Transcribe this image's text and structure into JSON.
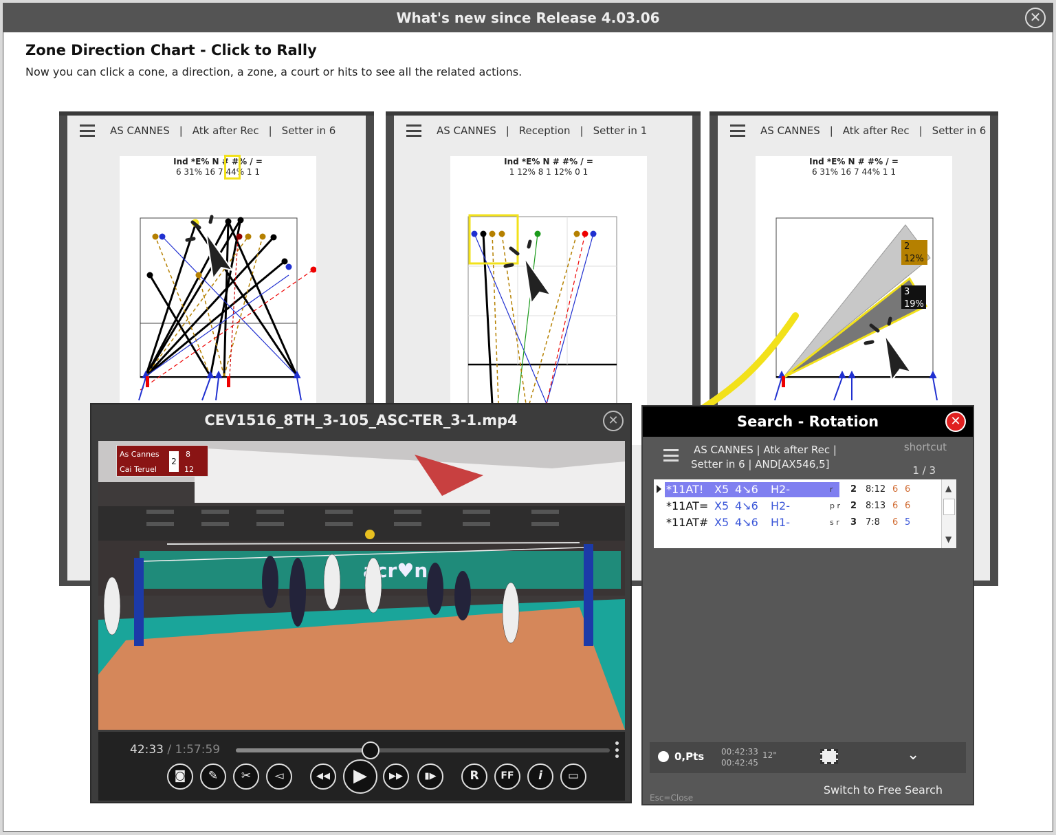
{
  "window": {
    "title": "What's new since Release 4.03.06",
    "close_label": "✕"
  },
  "intro": {
    "heading": "Zone Direction Chart - Click to Rally",
    "subheading": "Now you can click a cone, a direction, a zone, a court or hits to see all the related actions."
  },
  "panels": [
    {
      "team": "AS CANNES",
      "skill": "Atk after Rec",
      "rotation": "Setter in 6",
      "stats_header": "Ind *E% N  #  #%  /  =",
      "stats_values": "6  31% 16  7  44%  1  1"
    },
    {
      "team": "AS CANNES",
      "skill": "Reception",
      "rotation": "Setter in 1",
      "stats_header": "Ind *E% N  #  #%  /  =",
      "stats_values": "1  12%  8  1  12%  0  1"
    },
    {
      "team": "AS CANNES",
      "skill": "Atk after Rec",
      "rotation": "Setter in 6",
      "stats_header": "Ind *E% N  #  #%  /  =",
      "stats_values": "6  31% 16  7  44%  1  1",
      "cone_labels": [
        {
          "value": "2",
          "pct": "12%"
        },
        {
          "value": "3",
          "pct": "19%"
        }
      ]
    }
  ],
  "separator": "|",
  "video": {
    "title": "CEV1516_8TH_3-105_ASC-TER_3-1.mp4",
    "close_label": "✕",
    "current_time": "42:33",
    "total_time": "1:57:59",
    "progress": 0.36,
    "scoreboard": {
      "team1": "As Cannes",
      "team2": "Cai Teruel",
      "sets1": "2",
      "points1": "8",
      "points2": "12"
    },
    "sponsor_text": "acr♥n",
    "buttons": [
      "camera-icon",
      "pencil-icon",
      "scissors-icon",
      "mute-icon",
      "rewind-icon",
      "play-icon",
      "fast-forward-icon",
      "step-icon",
      "R",
      "FF",
      "info-icon",
      "screen-icon"
    ],
    "button_glyphs": {
      "camera": "◙",
      "pencil": "✎",
      "scissors": "✂",
      "mute": "◅",
      "rewind": "◀◀",
      "play": "▶",
      "ffwd": "▶▶",
      "step": "▮▶",
      "r": "R",
      "ff": "FF",
      "info": "i",
      "screen": "▭"
    }
  },
  "search": {
    "title": "Search - Rotation",
    "close_label": "✕",
    "line1": "AS CANNES  |  Atk after Rec  |",
    "line2": "Setter in 6  |  AND[AX546,5]",
    "shortcut": "shortcut",
    "pager": "1 / 3",
    "rows": [
      {
        "code": "*11AT!",
        "zone": "X5",
        "dir": "4↘6",
        "eval": "H2-",
        "m1": "r",
        "n": "2",
        "score": "8:12",
        "s1": "6",
        "s2": "6",
        "s2_color": "#d06a30"
      },
      {
        "code": "*11AT=",
        "zone": "X5",
        "dir": "4↘6",
        "eval": "H2-",
        "m1": "p  r",
        "n": "2",
        "score": "8:13",
        "s1": "6",
        "s2": "6",
        "s2_color": "#d06a30"
      },
      {
        "code": "*11AT#",
        "zone": "X5",
        "dir": "4↘6",
        "eval": "H1-",
        "m1": "s  r",
        "n": "3",
        "score": "7:8",
        "s1": "6",
        "s2": "5",
        "s2_color": "#3a56d8"
      }
    ],
    "points": "0,Pts",
    "timecode_start": "00:42:33",
    "timecode_end": "00:42:45",
    "duration": "12\"",
    "switch_label": "Switch to Free Search",
    "esc_label": "Esc=Close"
  },
  "colors": {
    "accent_yellow": "#f2e11a",
    "selection": "#7f7ff0",
    "close_red": "#e02020"
  }
}
